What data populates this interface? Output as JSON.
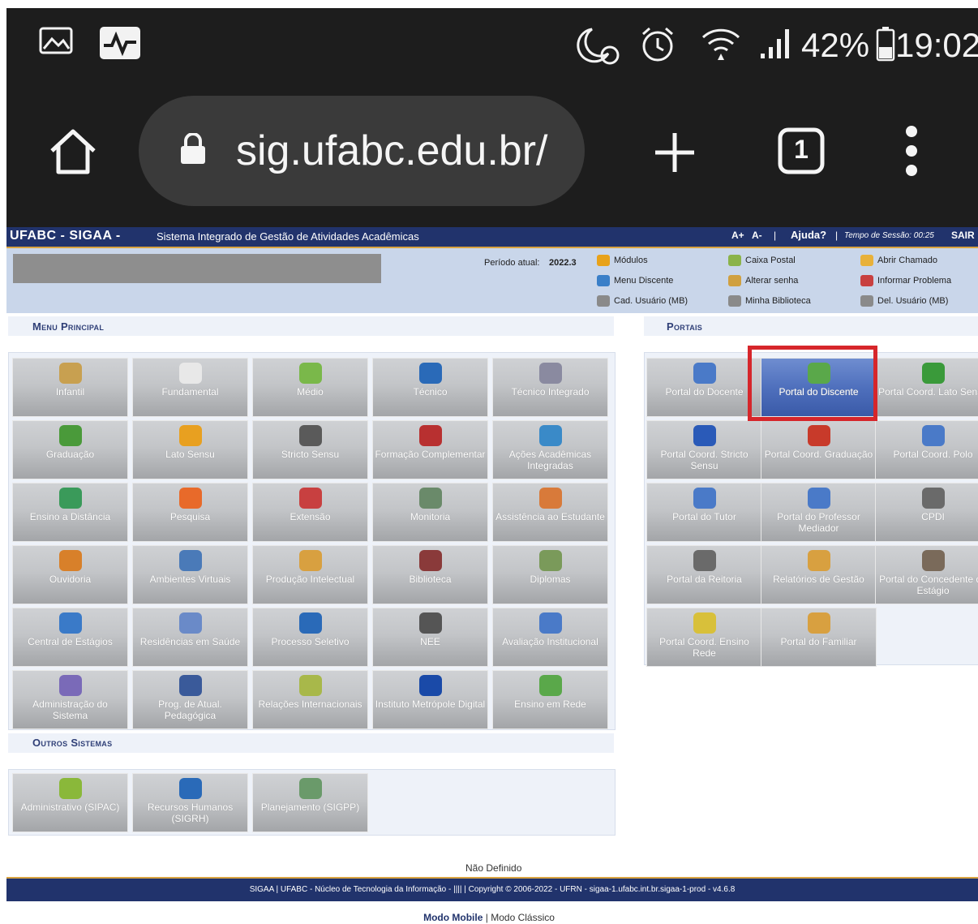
{
  "phone_status": {
    "battery": "42%",
    "time": "19:02",
    "icons": [
      "gallery-icon",
      "pulse-icon",
      "do-not-disturb-alarm-icon",
      "alarm-icon",
      "wifi-icon",
      "signal-icon",
      "battery-icon"
    ]
  },
  "browser": {
    "url": "sig.ufabc.edu.br/",
    "tab_count": "1",
    "icons": [
      "home-icon",
      "lock-icon",
      "new-tab-icon",
      "tabs-icon",
      "more-menu-icon"
    ]
  },
  "header": {
    "brand": "UFABC - SIGAA -",
    "system_name": "Sistema Integrado de Gestão de Atividades Acadêmicas",
    "font_increase": "A+",
    "font_decrease": "A-",
    "help": "Ajuda?",
    "session_label": "Tempo de Sessão: 00:25",
    "logout": "SAIR"
  },
  "userbar": {
    "period_label": "Período atual:",
    "period_value": "2022.3",
    "links": [
      {
        "label": "Módulos",
        "icon": "modules-icon",
        "color": "#e8a21a"
      },
      {
        "label": "Caixa Postal",
        "icon": "mailbox-icon",
        "color": "#8bb34a"
      },
      {
        "label": "Abrir Chamado",
        "icon": "ticket-icon",
        "color": "#e8b13a"
      },
      {
        "label": "Menu Discente",
        "icon": "student-menu-icon",
        "color": "#3a7fc8"
      },
      {
        "label": "Alterar senha",
        "icon": "password-icon",
        "color": "#d0a040"
      },
      {
        "label": "Informar Problema",
        "icon": "report-problem-icon",
        "color": "#c84040"
      },
      {
        "label": "Cad. Usuário (MB)",
        "icon": "register-user-icon",
        "color": "#8a8a8a"
      },
      {
        "label": "Minha Biblioteca",
        "icon": "library-icon",
        "color": "#8a8a8a"
      },
      {
        "label": "Del. Usuário (MB)",
        "icon": "delete-user-icon",
        "color": "#8a8a8a"
      }
    ]
  },
  "menu_principal": {
    "title": "Menu Principal",
    "items": [
      {
        "label": "Infantil",
        "icon": "infantil-icon",
        "color": "#c8a050"
      },
      {
        "label": "Fundamental",
        "icon": "fundamental-icon",
        "color": "#e8e8e8"
      },
      {
        "label": "Médio",
        "icon": "medio-icon",
        "color": "#7ab84a"
      },
      {
        "label": "Técnico",
        "icon": "tecnico-icon",
        "color": "#2a6ab8"
      },
      {
        "label": "Técnico Integrado",
        "icon": "tecnico-integrado-icon",
        "color": "#8a8aa0"
      },
      {
        "label": "Graduação",
        "icon": "graduacao-icon",
        "color": "#4a9a3a"
      },
      {
        "label": "Lato Sensu",
        "icon": "lato-sensu-icon",
        "color": "#e8a020"
      },
      {
        "label": "Stricto Sensu",
        "icon": "stricto-sensu-icon",
        "color": "#5a5a5a"
      },
      {
        "label": "Formação Complementar",
        "icon": "formacao-icon",
        "color": "#b83030"
      },
      {
        "label": "Ações Acadêmicas Integradas",
        "icon": "acoes-icon",
        "color": "#3a8ac8"
      },
      {
        "label": "Ensino a Distância",
        "icon": "ead-icon",
        "color": "#3a9a5a"
      },
      {
        "label": "Pesquisa",
        "icon": "pesquisa-icon",
        "color": "#e86a2a"
      },
      {
        "label": "Extensão",
        "icon": "extensao-icon",
        "color": "#c84040"
      },
      {
        "label": "Monitoria",
        "icon": "monitoria-icon",
        "color": "#6a8a6a"
      },
      {
        "label": "Assistência ao Estudante",
        "icon": "assistencia-icon",
        "color": "#d87a3a"
      },
      {
        "label": "Ouvidoria",
        "icon": "ouvidoria-icon",
        "color": "#d8802a"
      },
      {
        "label": "Ambientes Virtuais",
        "icon": "ambientes-icon",
        "color": "#4a7ab8"
      },
      {
        "label": "Produção Intelectual",
        "icon": "producao-icon",
        "color": "#d8a040"
      },
      {
        "label": "Biblioteca",
        "icon": "biblioteca-icon",
        "color": "#8a3a3a"
      },
      {
        "label": "Diplomas",
        "icon": "diplomas-icon",
        "color": "#7a9a5a"
      },
      {
        "label": "Central de Estágios",
        "icon": "estagios-icon",
        "color": "#3a7ac8"
      },
      {
        "label": "Residências em Saúde",
        "icon": "residencias-icon",
        "color": "#6a8ac8"
      },
      {
        "label": "Processo Seletivo",
        "icon": "processo-icon",
        "color": "#2a6ab8"
      },
      {
        "label": "NEE",
        "icon": "nee-icon",
        "color": "#555555"
      },
      {
        "label": "Avaliação Institucional",
        "icon": "avaliacao-icon",
        "color": "#4a7ac8"
      },
      {
        "label": "Administração do Sistema",
        "icon": "admin-icon",
        "color": "#7a6ab8"
      },
      {
        "label": "Prog. de Atual. Pedagógica",
        "icon": "prog-atual-icon",
        "color": "#3a5a9a"
      },
      {
        "label": "Relações Internacionais",
        "icon": "relacoes-icon",
        "color": "#a8b84a"
      },
      {
        "label": "Instituto Metrópole Digital",
        "icon": "imd-icon",
        "color": "#1a4aa8"
      },
      {
        "label": "Ensino em Rede",
        "icon": "ensino-rede-icon",
        "color": "#5aa84a"
      }
    ]
  },
  "outros_sistemas": {
    "title": "Outros Sistemas",
    "items": [
      {
        "label": "Administrativo (SIPAC)",
        "icon": "sipac-icon",
        "color": "#8ab83a"
      },
      {
        "label": "Recursos Humanos (SIGRH)",
        "icon": "sigrh-icon",
        "color": "#2a6ab8"
      },
      {
        "label": "Planejamento (SIGPP)",
        "icon": "sigpp-icon",
        "color": "#6a9a6a"
      }
    ]
  },
  "portais": {
    "title": "Portais",
    "items": [
      {
        "label": "Portal do Docente",
        "icon": "docente-icon",
        "color": "#4a7ac8"
      },
      {
        "label": "Portal do Discente",
        "icon": "discente-icon",
        "color": "#5aa84a",
        "selected": true
      },
      {
        "label": "Portal Coord. Lato Sensu",
        "icon": "coord-lato-icon",
        "color": "#3a9a3a"
      },
      {
        "label": "Portal Coord. Stricto Sensu",
        "icon": "coord-stricto-icon",
        "color": "#2a5ab8"
      },
      {
        "label": "Portal Coord. Graduação",
        "icon": "coord-graduacao-icon",
        "color": "#c83a2a"
      },
      {
        "label": "Portal Coord. Polo",
        "icon": "coord-polo-icon",
        "color": "#4a7ac8"
      },
      {
        "label": "Portal do Tutor",
        "icon": "tutor-icon",
        "color": "#4a7ac8"
      },
      {
        "label": "Portal do Professor Mediador",
        "icon": "mediador-icon",
        "color": "#4a7ac8"
      },
      {
        "label": "CPDI",
        "icon": "cpdi-icon",
        "color": "#6a6a6a"
      },
      {
        "label": "Portal da Reitoria",
        "icon": "reitoria-icon",
        "color": "#6a6a6a"
      },
      {
        "label": "Relatórios de Gestão",
        "icon": "relatorios-icon",
        "color": "#d8a040"
      },
      {
        "label": "Portal do Concedente de Estágio",
        "icon": "concedente-icon",
        "color": "#7a6a5a"
      },
      {
        "label": "Portal Coord. Ensino Rede",
        "icon": "coord-ensino-rede-icon",
        "color": "#d8c03a"
      },
      {
        "label": "Portal do Familiar",
        "icon": "familiar-icon",
        "color": "#d8a040"
      }
    ]
  },
  "footer": {
    "undefined_label": "Não Definido",
    "copyright": "SIGAA | UFABC - Núcleo de Tecnologia da Informação - |||| | Copyright © 2006-2022 - UFRN - sigaa-1.ufabc.int.br.sigaa-1-prod - v4.6.8",
    "mode_mobile": "Modo Mobile",
    "mode_separator": "|",
    "mode_classic": "Modo Clássico"
  }
}
